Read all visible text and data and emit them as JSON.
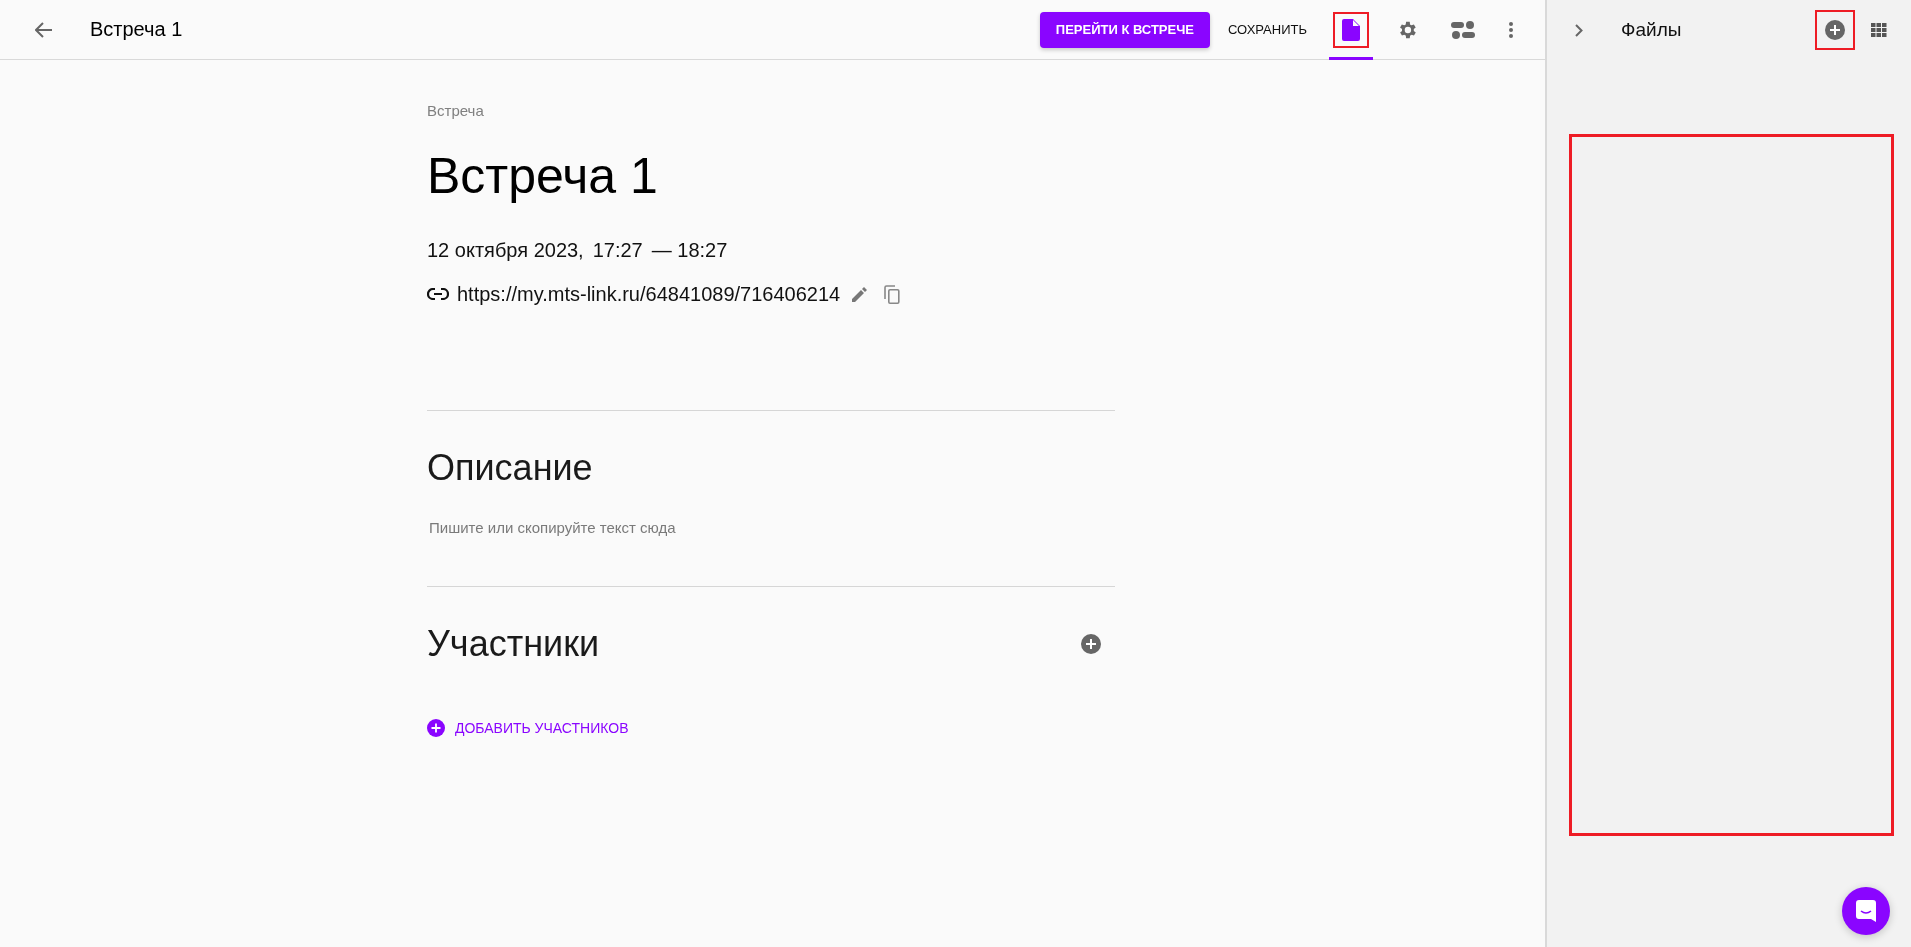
{
  "header": {
    "title": "Встреча 1",
    "primary_button": "ПЕРЕЙТИ К ВСТРЕЧЕ",
    "save_button": "СОХРАНИТЬ",
    "tools": [
      {
        "kind": "file",
        "selected": true,
        "highlighted": true
      },
      {
        "kind": "settings",
        "selected": false,
        "highlighted": false
      },
      {
        "kind": "layout",
        "selected": false,
        "highlighted": false
      }
    ]
  },
  "event": {
    "breadcrumb": "Встреча",
    "title": "Встреча 1",
    "date": "12 октября 2023,",
    "start": "17:27",
    "end": "— 18:27",
    "link": "https://my.mts-link.ru/64841089/716406214"
  },
  "description": {
    "heading": "Описание",
    "placeholder": "Пишите или скопируйте текст сюда"
  },
  "participants": {
    "heading": "Участники",
    "add_link": "ДОБАВИТЬ УЧАСТНИКОВ"
  },
  "files_panel": {
    "title": "Файлы",
    "add_highlighted": true,
    "drop_area_highlighted": true
  }
}
